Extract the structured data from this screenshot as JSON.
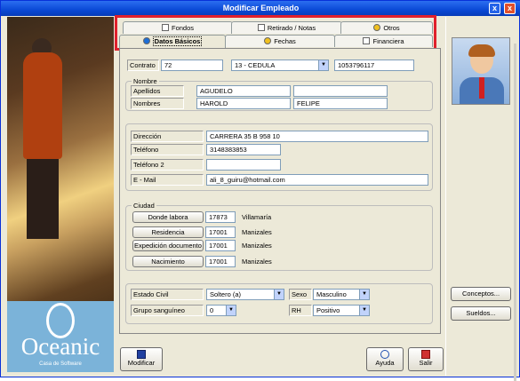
{
  "window": {
    "title": "Modificar Empleado",
    "close_label": "x",
    "close2_label": "x"
  },
  "tabs": {
    "row1": [
      "Fondos",
      "Retirado / Notas",
      "Otros"
    ],
    "row2": [
      "Datos Básicos",
      "Fechas",
      "Financiera"
    ]
  },
  "contract": {
    "label": "Contrato",
    "value": "72",
    "id_type": "13 - CEDULA",
    "id_number": "1053796117"
  },
  "name": {
    "group": "Nombre",
    "surname_label": "Apellidos",
    "surname1": "AGUDELO",
    "surname2": "",
    "names_label": "Nombres",
    "name1": "HAROLD",
    "name2": "FELIPE"
  },
  "contact": {
    "address_label": "Dirección",
    "address": "CARRERA 35 B 958 10",
    "phone_label": "Teléfono",
    "phone": "3148383853",
    "phone2_label": "Teléfono 2",
    "phone2": "",
    "email_label": "E - Mail",
    "email": "ali_8_guiru@hotmail.com"
  },
  "city": {
    "group": "Ciudad",
    "rows": [
      {
        "button": "Donde labora",
        "code": "17873",
        "name": "Villamaría"
      },
      {
        "button": "Residencia",
        "code": "17001",
        "name": "Manizales"
      },
      {
        "button": "Expedición documento",
        "code": "17001",
        "name": "Manizales"
      },
      {
        "button": "Nacimiento",
        "code": "17001",
        "name": "Manizales"
      }
    ]
  },
  "misc": {
    "civil_label": "Estado Civil",
    "civil": "Soltero (a)",
    "sex_label": "Sexo",
    "sex": "Masculino",
    "blood_label": "Grupo sanguíneo",
    "blood": "0",
    "rh_label": "RH",
    "rh": "Positivo"
  },
  "buttons": {
    "modify": "Modificar",
    "help": "Ayuda",
    "exit": "Salir",
    "concepts": "Conceptos...",
    "salaries": "Sueldos..."
  },
  "logo": {
    "brand": "Oceanic",
    "tagline": "Casa de Software",
    "letter": "O"
  },
  "dropdown_glyph": "▼"
}
